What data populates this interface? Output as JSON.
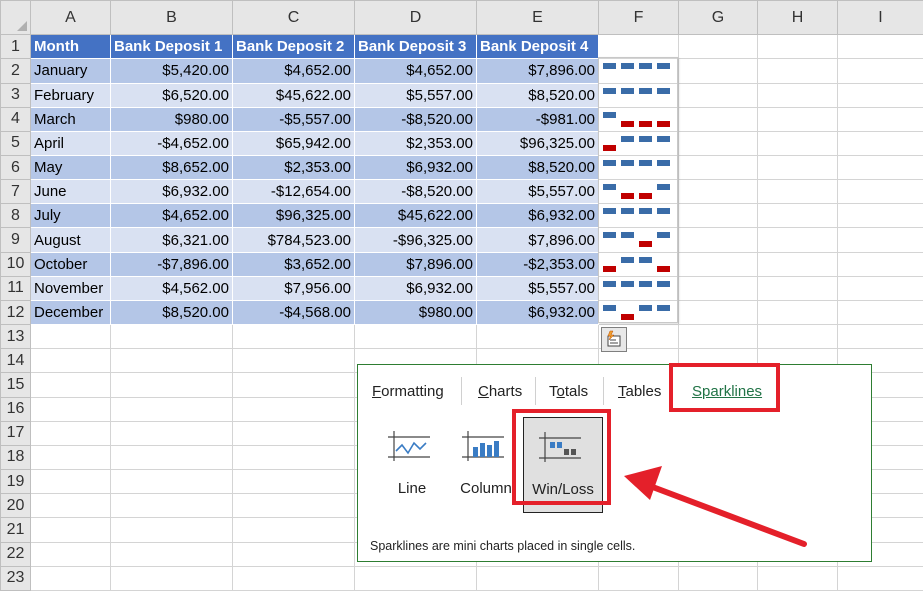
{
  "columns": [
    "A",
    "B",
    "C",
    "D",
    "E",
    "F",
    "G",
    "H",
    "I"
  ],
  "rows": [
    1,
    2,
    3,
    4,
    5,
    6,
    7,
    8,
    9,
    10,
    11,
    12,
    13,
    14,
    15,
    16,
    17,
    18,
    19,
    20,
    21,
    22,
    23
  ],
  "table": {
    "headers": [
      "Month",
      "Bank Deposit 1",
      "Bank Deposit 2",
      "Bank Deposit 3",
      "Bank Deposit 4"
    ],
    "data": [
      [
        "January",
        "$5,420.00",
        "$4,652.00",
        "$4,652.00",
        "$7,896.00"
      ],
      [
        "February",
        "$6,520.00",
        "$45,622.00",
        "$5,557.00",
        "$8,520.00"
      ],
      [
        "March",
        "$980.00",
        "-$5,557.00",
        "-$8,520.00",
        "-$981.00"
      ],
      [
        "April",
        "-$4,652.00",
        "$65,942.00",
        "$2,353.00",
        "$96,325.00"
      ],
      [
        "May",
        "$8,652.00",
        "$2,353.00",
        "$6,932.00",
        "$8,520.00"
      ],
      [
        "June",
        "$6,932.00",
        "-$12,654.00",
        "-$8,520.00",
        "$5,557.00"
      ],
      [
        "July",
        "$4,652.00",
        "$96,325.00",
        "$45,622.00",
        "$6,932.00"
      ],
      [
        "August",
        "$6,321.00",
        "$784,523.00",
        "-$96,325.00",
        "$7,896.00"
      ],
      [
        "October",
        "-$7,896.00",
        "$3,652.00",
        "$7,896.00",
        "-$2,353.00"
      ],
      [
        "November",
        "$4,562.00",
        "$7,956.00",
        "$6,932.00",
        "$5,557.00"
      ],
      [
        "December",
        "$8,520.00",
        "-$4,568.00",
        "$980.00",
        "$6,932.00"
      ]
    ]
  },
  "sparklines": {
    "type": "win-loss",
    "win_color": "#3a6ca8",
    "loss_color": "#c00000",
    "signs": [
      [
        1,
        1,
        1,
        1
      ],
      [
        1,
        1,
        1,
        1
      ],
      [
        1,
        -1,
        -1,
        -1
      ],
      [
        -1,
        1,
        1,
        1
      ],
      [
        1,
        1,
        1,
        1
      ],
      [
        1,
        -1,
        -1,
        1
      ],
      [
        1,
        1,
        1,
        1
      ],
      [
        1,
        1,
        -1,
        1
      ],
      [
        -1,
        1,
        1,
        -1
      ],
      [
        1,
        1,
        1,
        1
      ],
      [
        1,
        -1,
        1,
        1
      ]
    ]
  },
  "quick_analysis": {
    "tabs": [
      {
        "label": "Formatting",
        "accel": "F",
        "rest": "ormatting"
      },
      {
        "label": "Charts",
        "accel": "C",
        "rest": "harts"
      },
      {
        "label": "Totals",
        "accel": "o",
        "pre": "T",
        "rest": "tals"
      },
      {
        "label": "Tables",
        "accel": "T",
        "rest": "ables"
      },
      {
        "label": "Sparklines",
        "accel": "S",
        "rest": "parklines"
      }
    ],
    "active_tab": "Sparklines",
    "gallery": [
      "Line",
      "Column",
      "Win/Loss"
    ],
    "selected": "Win/Loss",
    "description": "Sparklines are mini charts placed in single cells."
  },
  "colors": {
    "header_fill": "#4472c4",
    "band_dark": "#b4c6e7",
    "band_light": "#d9e1f2",
    "highlight": "#e4202a",
    "panel_border": "#2e7d32"
  }
}
